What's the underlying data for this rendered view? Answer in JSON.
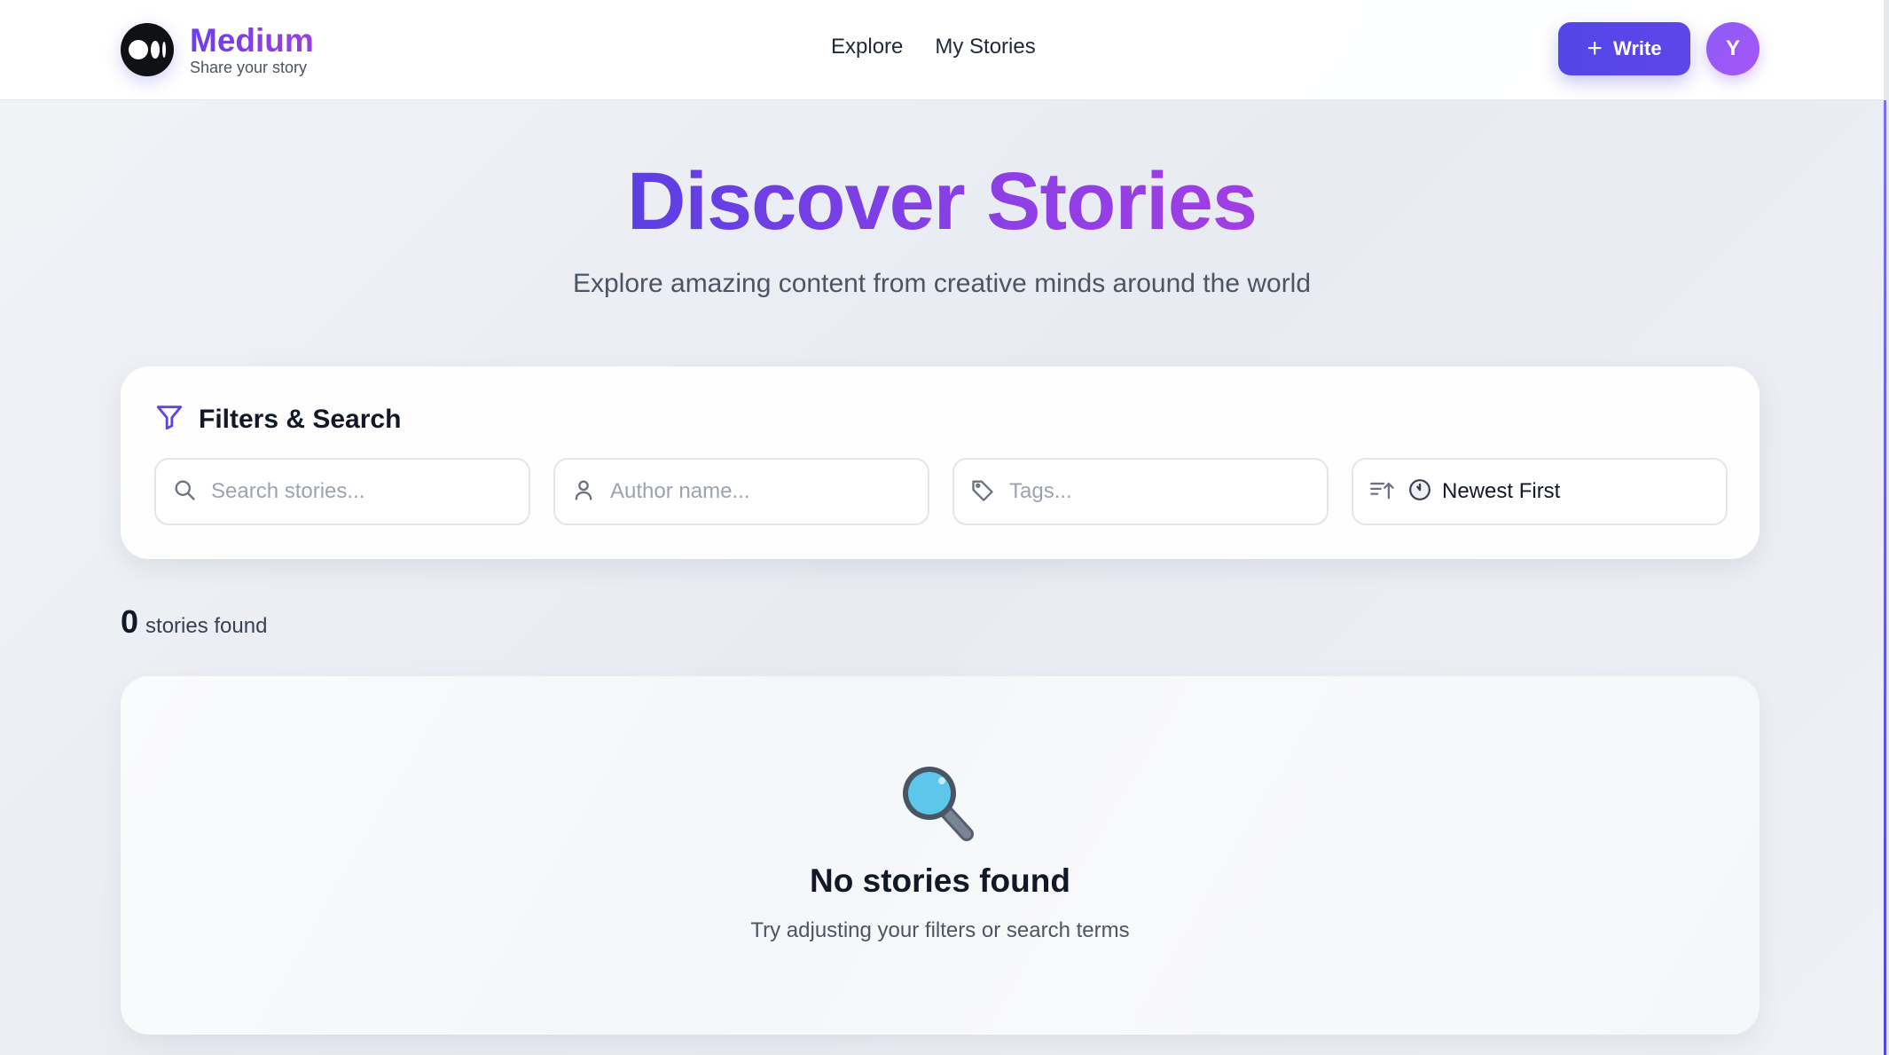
{
  "app": {
    "name": "Medium",
    "tagline": "Share your story"
  },
  "nav": {
    "items": [
      {
        "label": "Explore"
      },
      {
        "label": "My Stories"
      }
    ]
  },
  "header": {
    "write_label": "Write",
    "avatar_initial": "Y"
  },
  "hero": {
    "title": "Discover Stories",
    "subtitle": "Explore amazing content from creative minds around the world"
  },
  "filters": {
    "title": "Filters & Search",
    "search": {
      "placeholder": "Search stories...",
      "value": ""
    },
    "author": {
      "placeholder": "Author name...",
      "value": ""
    },
    "tags": {
      "placeholder": "Tags...",
      "value": ""
    },
    "sort": {
      "selected": "Newest First"
    }
  },
  "results": {
    "count": "0",
    "count_label": "stories found"
  },
  "empty_state": {
    "title": "No stories found",
    "message": "Try adjusting your filters or search terms"
  },
  "colors": {
    "accent": "#5246e6",
    "brand_gradient_start": "#6d3ee8",
    "brand_gradient_end": "#a13ee4",
    "avatar": "#9b5cf6"
  },
  "icons": {
    "filter": "filter-icon",
    "search": "search-icon",
    "author": "user-icon",
    "tags": "tag-icon",
    "sort": "sort-icon",
    "clock": "clock-icon",
    "empty": "magnifying-glass-icon"
  }
}
